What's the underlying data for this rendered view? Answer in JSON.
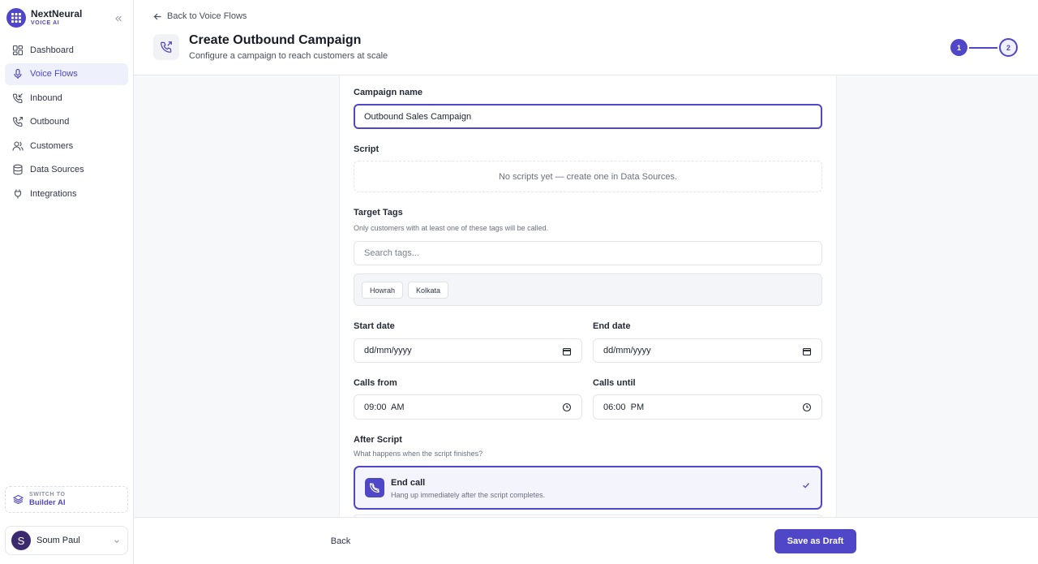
{
  "brand": {
    "name": "NextNeural",
    "subtitle": "VOICE AI",
    "accent": "#4f46c8"
  },
  "sidebar": {
    "items": [
      {
        "label": "Dashboard",
        "icon": "dashboard-icon",
        "active": false
      },
      {
        "label": "Voice Flows",
        "icon": "microphone-icon",
        "active": true
      },
      {
        "label": "Inbound",
        "icon": "phone-incoming-icon",
        "active": false
      },
      {
        "label": "Outbound",
        "icon": "phone-outgoing-icon",
        "active": false
      },
      {
        "label": "Customers",
        "icon": "users-icon",
        "active": false
      },
      {
        "label": "Data Sources",
        "icon": "database-icon",
        "active": false
      },
      {
        "label": "Integrations",
        "icon": "plug-icon",
        "active": false
      }
    ],
    "switch": {
      "small": "SWITCH TO",
      "big": "Builder AI"
    },
    "user": {
      "initial": "S",
      "name": "Soum Paul"
    }
  },
  "header": {
    "back_label": "Back to Voice Flows",
    "title": "Create Outbound Campaign",
    "subtitle": "Configure a campaign to reach customers at scale",
    "steps": [
      "1",
      "2"
    ],
    "current_step": 1
  },
  "form": {
    "campaign_name": {
      "label": "Campaign name",
      "value": "Outbound Sales Campaign"
    },
    "script": {
      "label": "Script",
      "empty_text": "No scripts yet — create one in Data Sources."
    },
    "target_tags": {
      "label": "Target Tags",
      "hint": "Only customers with at least one of these tags will be called.",
      "search_placeholder": "Search tags...",
      "tags": [
        "Howrah",
        "Kolkata"
      ]
    },
    "start_date": {
      "label": "Start date",
      "value": "dd/mm/yyyy"
    },
    "end_date": {
      "label": "End date",
      "value": "dd/mm/yyyy"
    },
    "calls_from": {
      "label": "Calls from",
      "value": "09:00  AM"
    },
    "calls_until": {
      "label": "Calls until",
      "value": "06:00  PM"
    },
    "after_script": {
      "label": "After Script",
      "hint": "What happens when the script finishes?",
      "options": [
        {
          "title": "End call",
          "description": "Hang up immediately after the script completes.",
          "selected": true,
          "icon": "phone-hangup-icon"
        }
      ]
    }
  },
  "footer": {
    "back_label": "Back",
    "save_label": "Save as Draft"
  }
}
